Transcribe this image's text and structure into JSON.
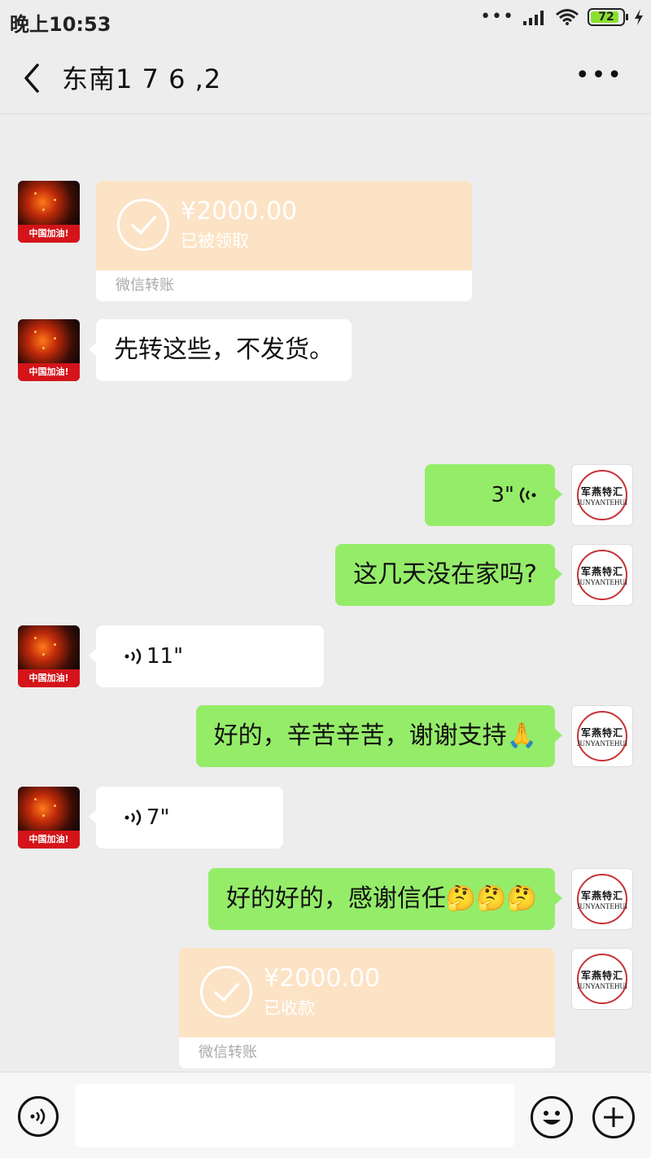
{
  "status_bar": {
    "time": "晚上10:53",
    "battery": "72"
  },
  "header": {
    "title": "东南1 7 6 ,2"
  },
  "messages": [
    {
      "side": "left",
      "type": "transfer",
      "amount": "¥2000.00",
      "status": "已被领取",
      "footer": "微信转账"
    },
    {
      "side": "left",
      "type": "text",
      "text": "先转这些，不发货。"
    },
    {
      "side": "right",
      "type": "voice",
      "duration": "3\""
    },
    {
      "side": "right",
      "type": "text",
      "text": "这几天没在家吗?"
    },
    {
      "side": "left",
      "type": "voice",
      "duration": "11\""
    },
    {
      "side": "right",
      "type": "text",
      "text": "好的，辛苦辛苦，谢谢支持🙏"
    },
    {
      "side": "left",
      "type": "voice",
      "duration": "7\""
    },
    {
      "side": "right",
      "type": "text",
      "text": "好的好的，感谢信任🤔🤔🤔"
    },
    {
      "side": "right",
      "type": "transfer",
      "amount": "¥2000.00",
      "status": "已收款",
      "footer": "微信转账"
    }
  ],
  "avatars": {
    "left_caption": "中国加油!",
    "right_stamp_cn": "军燕特汇",
    "right_stamp_en": "JUNYANTEHUI"
  },
  "colors": {
    "sent_bubble": "#95ec69",
    "received_bubble": "#ffffff",
    "transfer_card": "#fce3c5",
    "background": "#ededed"
  },
  "bottom_bar": {
    "input_value": ""
  }
}
